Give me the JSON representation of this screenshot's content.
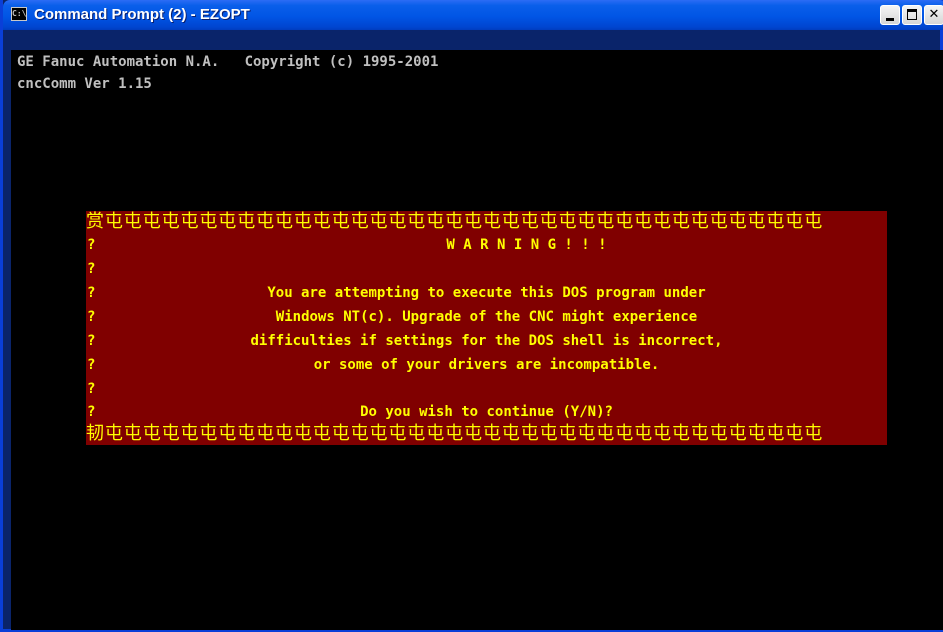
{
  "window": {
    "title": "Command Prompt (2) - EZOPT",
    "icon_name": "console-icon",
    "icon_text": "C:\\",
    "min_icon": "minimize-icon",
    "max_icon": "maximize-icon",
    "close_icon": "close-icon",
    "close_glyph": "✕"
  },
  "console": {
    "line1": "GE Fanuc Automation N.A.   Copyright (c) 1995-2001",
    "line2": "cncComm Ver 1.15"
  },
  "dialog": {
    "top_border": "赏屯屯屯屯屯屯屯屯屯屯屯屯屯屯屯屯屯屯屯屯屯屯屯屯屯屯屯屯屯屯屯屯屯屯屯屯屯屯",
    "bottom_border": "韧屯屯屯屯屯屯屯屯屯屯屯屯屯屯屯屯屯屯屯屯屯屯屯屯屯屯屯屯屯屯屯屯屯屯屯屯屯屯",
    "side_char": "?",
    "warning": "W A R N I N G ! ! !",
    "message_1": "You are attempting to execute this DOS program under",
    "message_2": "Windows NT(c). Upgrade of the CNC might experience",
    "message_3": "difficulties if settings for the DOS shell is incorrect,",
    "message_4": "or some of your drivers are incompatible.",
    "prompt": "Do you wish to continue (Y/N)?"
  },
  "colors": {
    "titlebar": "#0155E5",
    "console_bg": "#000000",
    "console_text": "#c0c0c0",
    "dialog_bg": "#800000",
    "dialog_text": "#ffff00"
  }
}
